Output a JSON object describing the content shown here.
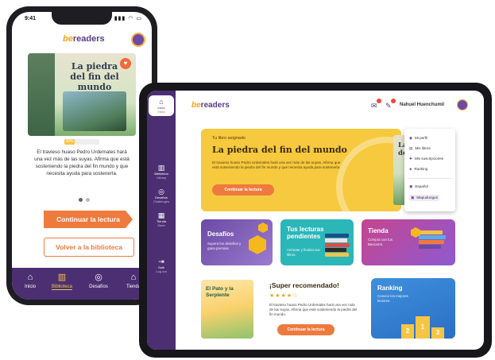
{
  "phone": {
    "status_time": "9:41",
    "status_icons": "▮▮▮ ◠ ▭",
    "logo": {
      "prefix": "be",
      "suffix": "readers"
    },
    "book_title": "La piedra del fin del mundo",
    "progress_percent": 30,
    "progress_label": "30%",
    "description": "El travieso huaso Pedro Urdemales hará una vez más de las suyas. Afirma que está sosteniendo la piedra del fin mundo y que necesita ayuda para sostenerla.",
    "continue_button": "Continuar la lectura",
    "back_button": "Volver a la biblioteca",
    "nav": [
      {
        "icon": "⌂",
        "label": "Inicio"
      },
      {
        "icon": "▥",
        "label": "Biblioteca"
      },
      {
        "icon": "◎",
        "label": "Desafíos"
      },
      {
        "icon": "⌂",
        "label": "Tienda"
      }
    ]
  },
  "tablet": {
    "sidebar": {
      "home": {
        "icon": "⌂",
        "label": "Inicio",
        "sub": "Inicio"
      },
      "items": [
        {
          "icon": "▥",
          "label": "Biblioteca",
          "sub": "Library"
        },
        {
          "icon": "◎",
          "label": "Desafíos",
          "sub": "Challenges"
        },
        {
          "icon": "▦",
          "label": "Tienda",
          "sub": "Store"
        }
      ],
      "logout": {
        "icon": "⇥",
        "label": "Salir",
        "sub": "Log out"
      }
    },
    "header": {
      "logo": {
        "prefix": "be",
        "suffix": "readers"
      },
      "user_name": "Nahuel Huenchumil",
      "icon_mail": "✉",
      "icon_notif": "✎"
    },
    "hero": {
      "eyebrow": "Tu libro asignado",
      "title": "La piedra del fin del mundo",
      "description": "El travieso huaso Pedro Urdemales hará una vez más de las suyas. Afirma que está sosteniendo la piedra del fin mundo y que necesita ayuda para sostenerla.",
      "button": "Continuar la lectura",
      "book_title": "La pie del fi"
    },
    "dropdown": {
      "items": [
        {
          "icon": "◉",
          "label": "Mi perfil"
        },
        {
          "icon": "▤",
          "label": "Mis libros"
        },
        {
          "icon": "✚",
          "label": "Mis suscripciones"
        },
        {
          "icon": "◈",
          "label": "Ranking"
        }
      ],
      "languages": [
        {
          "icon": "▣",
          "label": "Español",
          "selected": false
        },
        {
          "icon": "▣",
          "label": "Mapudungun",
          "selected": true
        }
      ]
    },
    "cards": {
      "desafios": {
        "title": "Desafíos",
        "sub": "Supera los desafíos y gana premios."
      },
      "lecturas": {
        "title": "Tus lecturas pendientes",
        "sub": "Anímate y finaliza tus libros."
      },
      "tienda": {
        "title": "Tienda",
        "sub": "Compra con tus Beecoins."
      },
      "ranking": {
        "title": "Ranking",
        "sub": "Conoce los mejores lectores."
      }
    },
    "super": {
      "cover_title": "El Pato y la Serpiente",
      "title": "¡Super recomendado!",
      "stars": "★★★★☆",
      "rating": 4,
      "description": "El travieso huaso Pedro Urdemales hará una vez más de las suyas. Afirma que está sosteniendo la piedra del fin mundo.",
      "button": "Continuar la lectura"
    },
    "podium": [
      "2",
      "1",
      "3"
    ]
  },
  "colors": {
    "brand_purple": "#4b2f72",
    "accent_orange": "#ef7a3e",
    "hero_yellow": "#f6c93e",
    "teal": "#2bb6b8"
  }
}
